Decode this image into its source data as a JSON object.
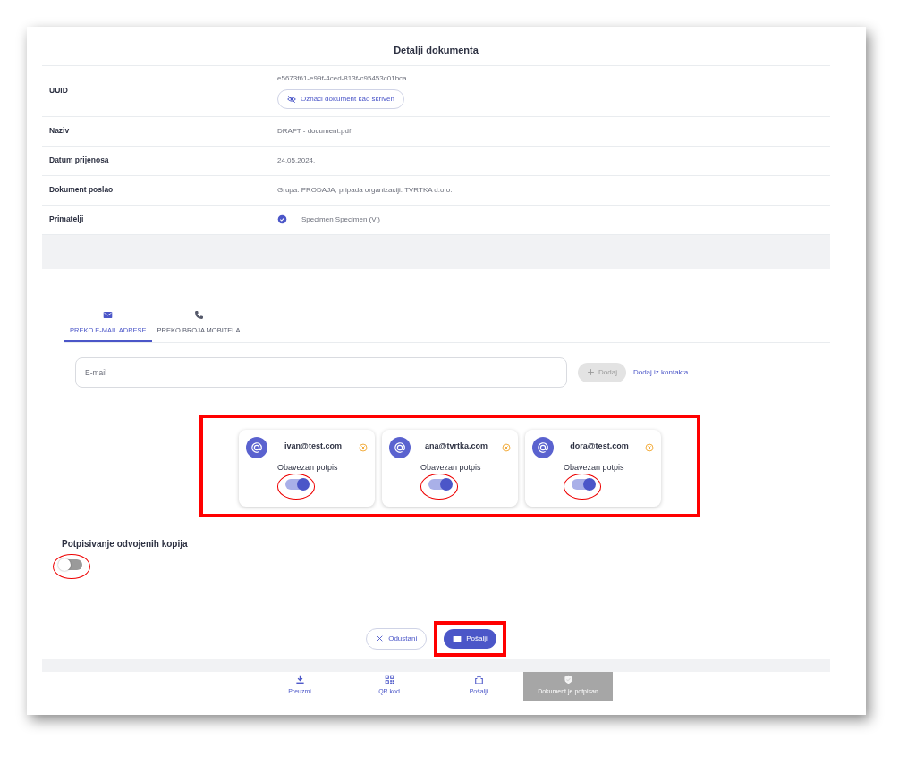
{
  "title": "Detalji dokumenta",
  "details": [
    {
      "label": "UUID",
      "value": "e5673f61-e99f-4ced-813f-c95453c01bca",
      "action": "Označi dokument kao skriven"
    },
    {
      "label": "Naziv",
      "value": "DRAFT - document.pdf"
    },
    {
      "label": "Datum prijenosa",
      "value": "24.05.2024."
    },
    {
      "label": "Dokument poslao",
      "value": "Grupa: PRODAJA, pripada organizaciji: TVRTKA d.o.o."
    },
    {
      "label": "Primatelji",
      "value": "Specimen Specimen (Vi)",
      "checked": true
    }
  ],
  "tabs": [
    {
      "kind": "email",
      "label": "PREKO E-MAIL ADRESE",
      "selected": true
    },
    {
      "kind": "phone",
      "label": "PREKO BROJA MOBITELA",
      "selected": false
    }
  ],
  "email_field": {
    "placeholder": "E-mail"
  },
  "add_button": {
    "label": "Dodaj",
    "disabled": true
  },
  "contacts_link": "Dodaj iz kontakta",
  "recipients_annotated": true,
  "recipients": [
    {
      "email": "ivan@test.com",
      "toggle_label": "Obavezan potpis",
      "on": true,
      "annotated": true
    },
    {
      "email": "ana@tvrtka.com",
      "toggle_label": "Obavezan potpis",
      "on": true,
      "annotated": true
    },
    {
      "email": "dora@test.com",
      "toggle_label": "Obavezan potpis",
      "on": true,
      "annotated": true
    }
  ],
  "separate_copies": {
    "label": "Potpisivanje odvojenih kopija",
    "on": false,
    "annotated": true
  },
  "cancel_button": "Odustani",
  "send_button": {
    "label": "Pošalji",
    "annotated": true
  },
  "bottom_nav": [
    {
      "kind": "download",
      "label": "Preuzmi",
      "disabled": false
    },
    {
      "kind": "qr",
      "label": "QR kod",
      "disabled": false
    },
    {
      "kind": "share",
      "label": "Pošalji",
      "disabled": false
    },
    {
      "kind": "shield",
      "label": "Dokument je potpisan",
      "disabled": true
    }
  ]
}
